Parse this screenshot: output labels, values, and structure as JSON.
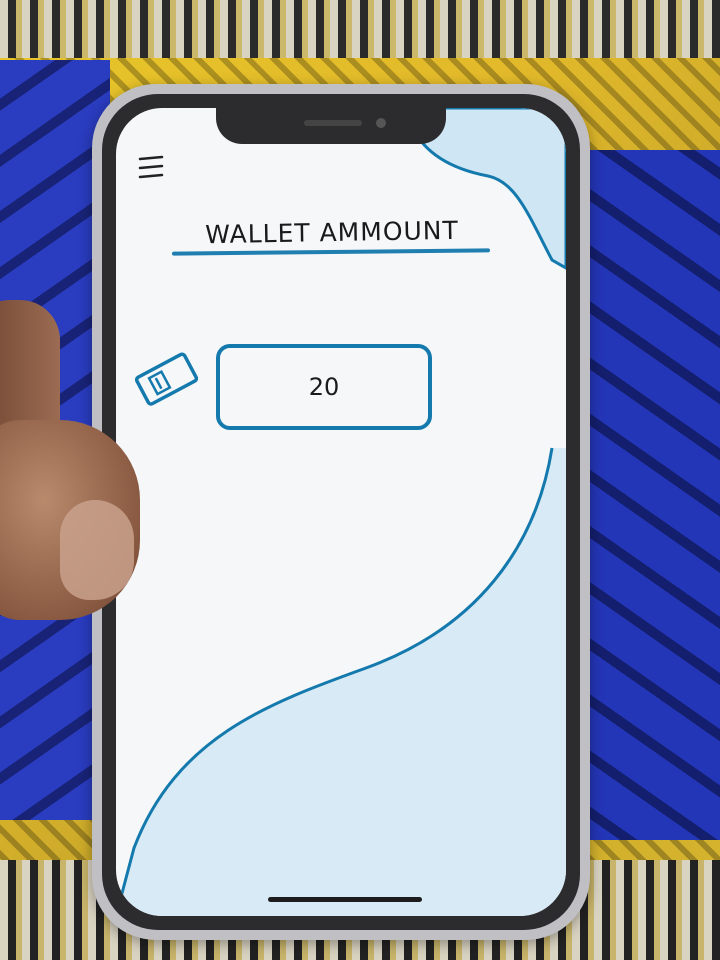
{
  "app": {
    "title": "WALLET AMMOUNT",
    "amount": "20"
  },
  "icons": {
    "menu": "hamburger-menu-icon",
    "wallet": "wallet-icon"
  },
  "colors": {
    "accent": "#1479ad",
    "wave_fill": "#cfe6f4",
    "screen_bg": "#f6f7f9"
  }
}
